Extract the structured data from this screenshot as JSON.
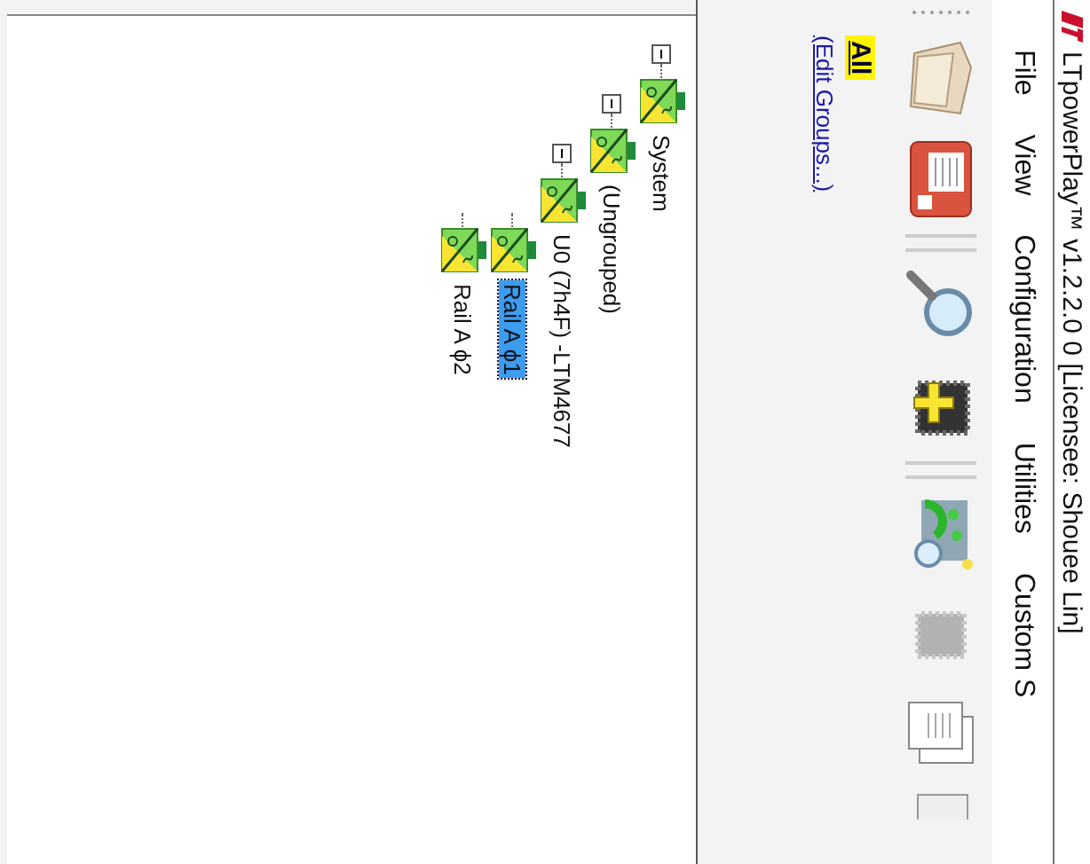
{
  "window": {
    "title": "LTpowerPlay™ v1.2.2.0 0 [Licensee: Shouee Lin]"
  },
  "menu": [
    "File",
    "View",
    "Configuration",
    "Utilities",
    "Custom S"
  ],
  "groups": {
    "items": [
      {
        "label": "All",
        "selected": true
      }
    ],
    "link": "(Edit Groups...)"
  },
  "tree": [
    {
      "label": "System",
      "expanded": true,
      "selected": false,
      "children": [
        {
          "label": "(Ungrouped)",
          "expanded": true,
          "selected": false,
          "children": [
            {
              "label": "U0 (7h4F) -LTM4677",
              "expanded": true,
              "selected": false,
              "children": [
                {
                  "label": "Rail A ϕ1",
                  "selected": true
                },
                {
                  "label": "Rail A ϕ2",
                  "selected": false
                }
              ]
            }
          ]
        }
      ]
    }
  ]
}
